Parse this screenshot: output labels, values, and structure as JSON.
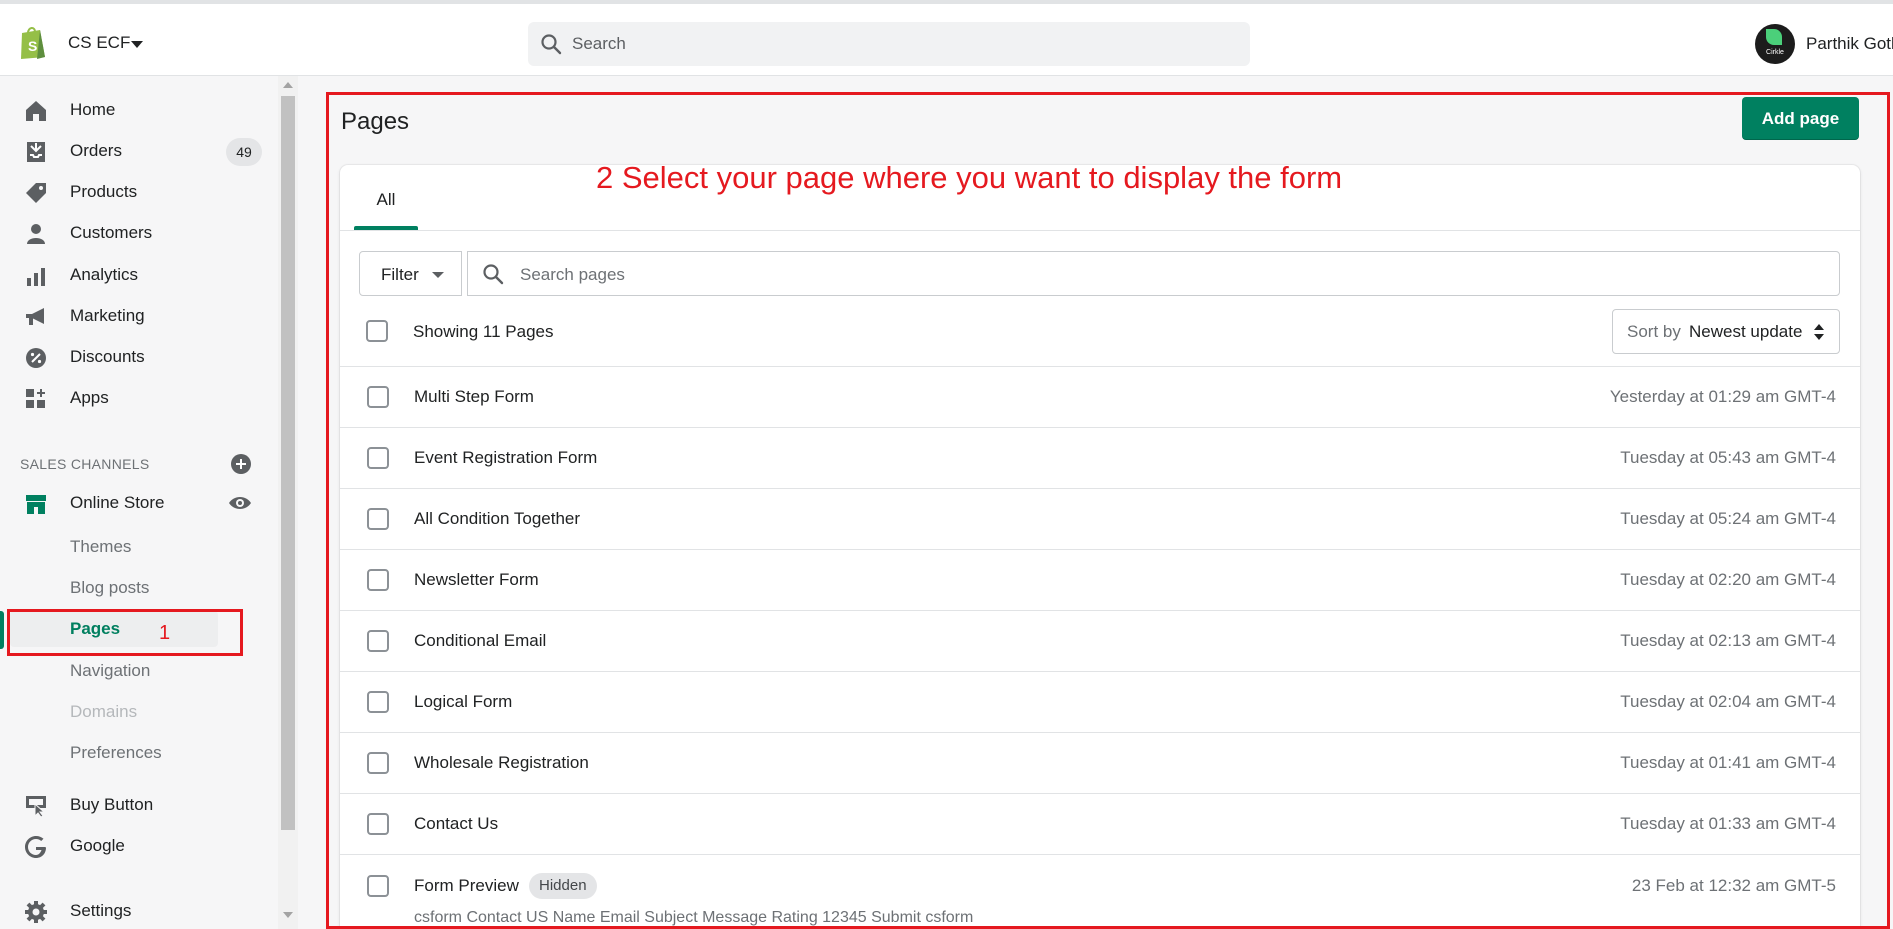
{
  "topbar": {
    "store_name": "CS ECF",
    "search_placeholder": "Search",
    "user_name": "Parthik Gothi",
    "avatar_text": "Cirkle"
  },
  "sidebar": {
    "items": [
      {
        "label": "Home",
        "icon": "home-icon"
      },
      {
        "label": "Orders",
        "icon": "orders-icon",
        "badge": "49"
      },
      {
        "label": "Products",
        "icon": "tag-icon"
      },
      {
        "label": "Customers",
        "icon": "person-icon"
      },
      {
        "label": "Analytics",
        "icon": "bar-chart-icon"
      },
      {
        "label": "Marketing",
        "icon": "megaphone-icon"
      },
      {
        "label": "Discounts",
        "icon": "discount-icon"
      },
      {
        "label": "Apps",
        "icon": "apps-icon"
      }
    ],
    "sales_channels_title": "SALES CHANNELS",
    "online_store": "Online Store",
    "sub_items": [
      "Themes",
      "Blog posts",
      "Pages",
      "Navigation",
      "Domains",
      "Preferences"
    ],
    "active_sub": "Pages",
    "bottom_items": [
      {
        "label": "Buy Button",
        "icon": "buy-button-icon"
      },
      {
        "label": "Google",
        "icon": "google-icon"
      },
      {
        "label": "Settings",
        "icon": "gear-icon"
      }
    ]
  },
  "annotations": {
    "step1": "1",
    "step2": "2 Select your page where you want to display the form"
  },
  "main": {
    "title": "Pages",
    "add_button": "Add page",
    "tab_all": "All",
    "filter_label": "Filter",
    "search_placeholder": "Search pages",
    "showing_text": "Showing 11 Pages",
    "sort_prefix": "Sort by",
    "sort_value": "Newest update",
    "hidden_label": "Hidden",
    "rows": [
      {
        "name": "Multi Step Form",
        "date": "Yesterday at 01:29 am GMT-4"
      },
      {
        "name": "Event Registration Form",
        "date": "Tuesday at 05:43 am GMT-4"
      },
      {
        "name": "All Condition Together",
        "date": "Tuesday at 05:24 am GMT-4"
      },
      {
        "name": "Newsletter Form",
        "date": "Tuesday at 02:20 am GMT-4"
      },
      {
        "name": "Conditional Email",
        "date": "Tuesday at 02:13 am GMT-4"
      },
      {
        "name": "Logical Form",
        "date": "Tuesday at 02:04 am GMT-4"
      },
      {
        "name": "Wholesale Registration",
        "date": "Tuesday at 01:41 am GMT-4"
      },
      {
        "name": "Contact Us",
        "date": "Tuesday at 01:33 am GMT-4"
      },
      {
        "name": "Form Preview",
        "date": "23 Feb at 12:32 am GMT-5",
        "hidden": true,
        "sub": "csform Contact US Name Email Subject Message Rating 12345 Submit csform"
      }
    ]
  },
  "colors": {
    "brand_green": "#008060",
    "annotation_red": "#e5191f"
  }
}
